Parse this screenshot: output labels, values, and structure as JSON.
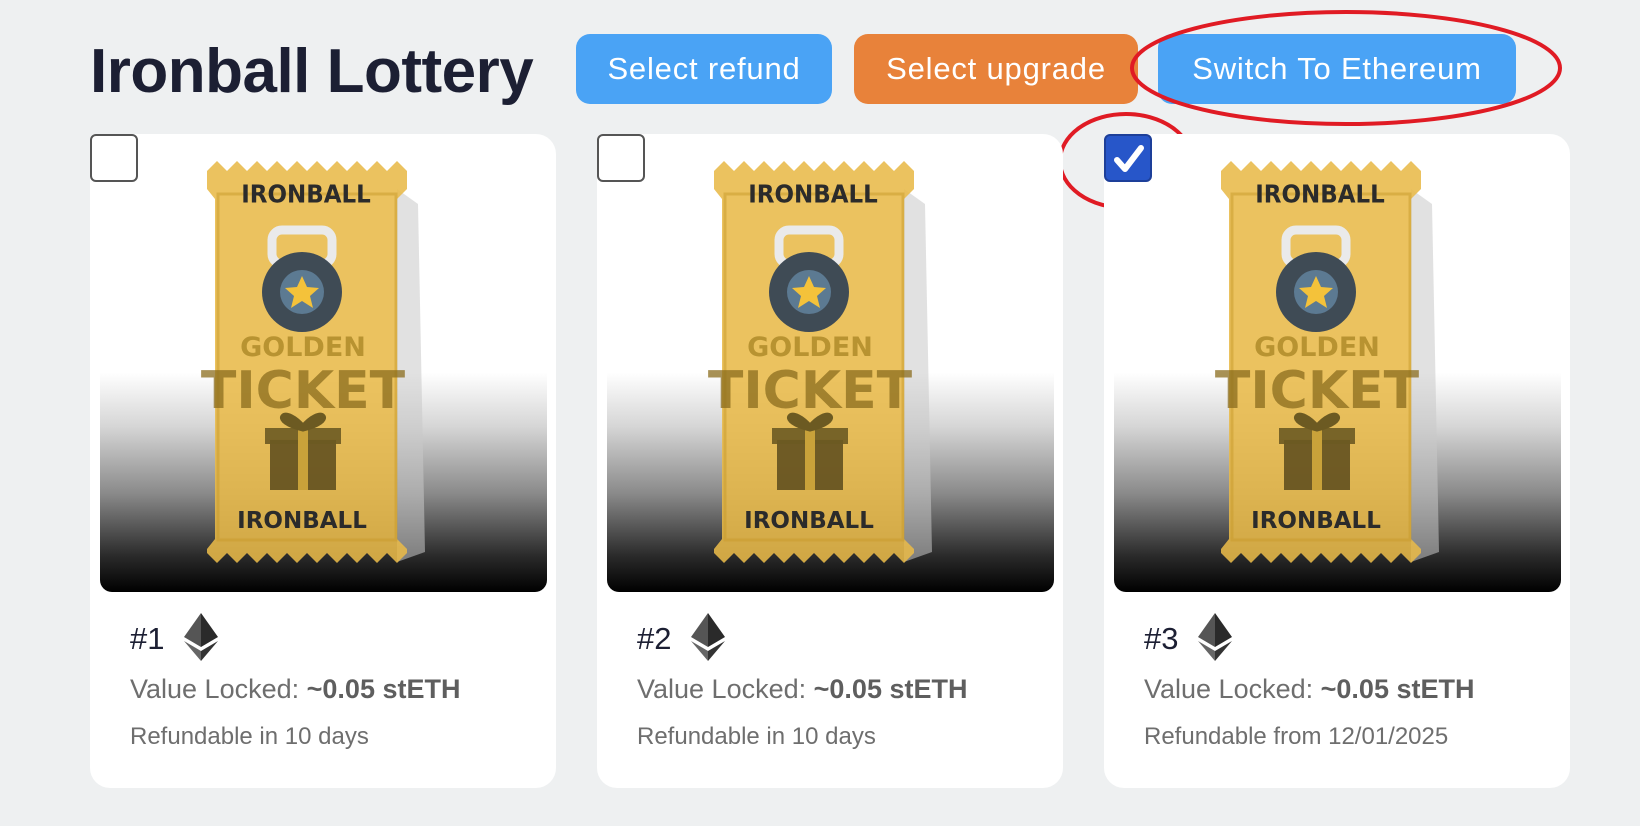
{
  "header": {
    "title": "Ironball Lottery",
    "select_refund_label": "Select refund",
    "select_upgrade_label": "Select upgrade",
    "switch_network_label": "Switch To Ethereum"
  },
  "ticket_art": {
    "brand_top": "IRONBALL",
    "line1": "GOLDEN",
    "line2": "TICKET",
    "brand_bottom": "IRONBALL"
  },
  "tickets": [
    {
      "id": "#1",
      "checked": false,
      "value_label": "Value Locked:",
      "value": "~0.05 stETH",
      "refund_text": "Refundable in 10 days"
    },
    {
      "id": "#2",
      "checked": false,
      "value_label": "Value Locked:",
      "value": "~0.05 stETH",
      "refund_text": "Refundable in 10 days"
    },
    {
      "id": "#3",
      "checked": true,
      "value_label": "Value Locked:",
      "value": "~0.05 stETH",
      "refund_text": "Refundable from 12/01/2025"
    }
  ],
  "icons": {
    "network": "ethereum-icon",
    "check": "checkmark-icon"
  },
  "colors": {
    "primary_button": "#4aa3f5",
    "upgrade_button": "#e8823a",
    "checkbox_checked": "#2756c9",
    "highlight_annotation": "#e01b24",
    "ticket_gold": "#e8b949"
  }
}
